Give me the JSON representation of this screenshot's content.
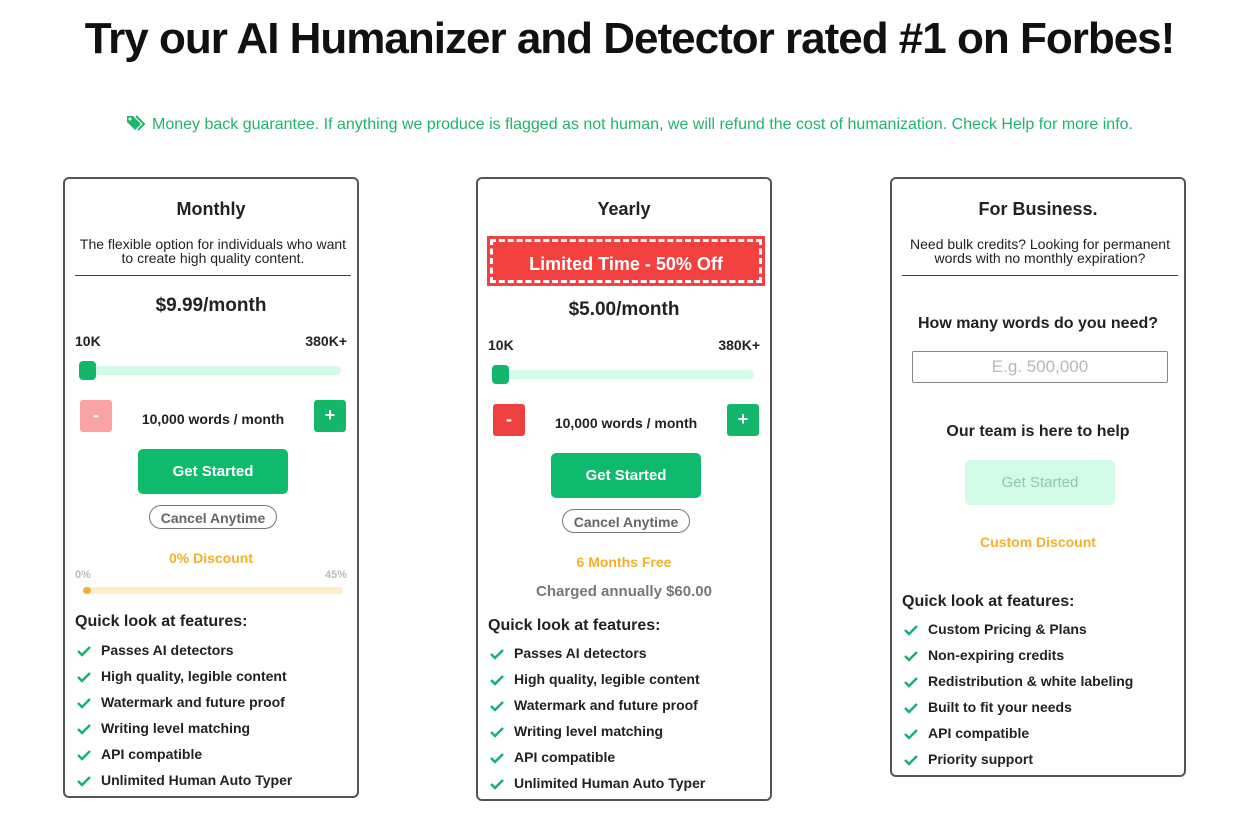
{
  "headline": "Try our AI Humanizer and Detector rated #1 on Forbes!",
  "guarantee": {
    "icon": "tag-icon",
    "text": "Money back guarantee. If anything we produce is flagged as not human, we will refund the cost of humanization. Check Help for more info."
  },
  "colors": {
    "brand_green": "#0fba6d",
    "discount_orange": "#f3b02a",
    "alert_red": "#f34141"
  },
  "monthly": {
    "title": "Monthly",
    "description": "The flexible option for individuals who want to create high quality content.",
    "price": "$9.99/month",
    "range_min": "10K",
    "range_max": "380K+",
    "slider_level": 0,
    "minus_label": "-",
    "plus_label": "+",
    "words": "10,000 words / month",
    "cta": "Get Started",
    "cancel": "Cancel Anytime",
    "discount": "0% Discount",
    "discount_min": "0%",
    "discount_max": "45%",
    "discount_level": 0,
    "features_heading": "Quick look at features:",
    "features": [
      "Passes AI detectors",
      "High quality, legible content",
      "Watermark and future proof",
      "Writing level matching",
      "API compatible",
      "Unlimited Human Auto Typer"
    ]
  },
  "yearly": {
    "title": "Yearly",
    "badge": "Limited Time - 50% Off",
    "price": "$5.00/month",
    "range_min": "10K",
    "range_max": "380K+",
    "slider_level": 0,
    "minus_label": "-",
    "plus_label": "+",
    "words": "10,000 words / month",
    "cta": "Get Started",
    "cancel": "Cancel Anytime",
    "free_months": "6 Months Free",
    "charged": "Charged annually $60.00",
    "features_heading": "Quick look at features:",
    "features": [
      "Passes AI detectors",
      "High quality, legible content",
      "Watermark and future proof",
      "Writing level matching",
      "API compatible",
      "Unlimited Human Auto Typer"
    ]
  },
  "business": {
    "title": "For Business.",
    "description": "Need bulk credits? Looking for permanent words with no monthly expiration?",
    "question": "How many words do you need?",
    "input_placeholder": "E.g. 500,000",
    "input_value": "",
    "help_text": "Our team is here to help",
    "cta": "Get Started",
    "discount": "Custom Discount",
    "features_heading": "Quick look at features:",
    "features": [
      "Custom Pricing & Plans",
      "Non-expiring credits",
      "Redistribution & white labeling",
      "Built to fit your needs",
      "API compatible",
      "Priority support"
    ]
  }
}
